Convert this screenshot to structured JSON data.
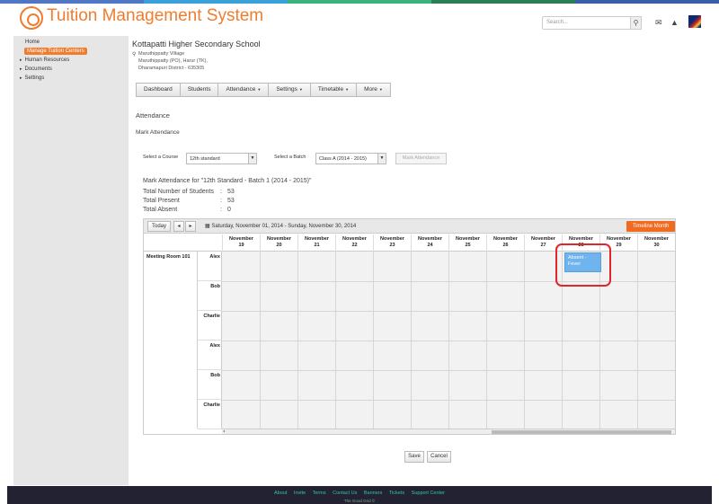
{
  "colors": {
    "brand": "#f07c2e",
    "accent": "#f06a20",
    "event": "#6fb3ef",
    "highlight": "#e0262b",
    "footer_link": "#34c7a0"
  },
  "header": {
    "title": "Tuition Management System",
    "search_placeholder": "Search...",
    "icons": [
      "search-icon",
      "mail-icon",
      "bell-icon"
    ]
  },
  "sidebar": {
    "items": [
      {
        "label": "Home"
      },
      {
        "label": "Manage Tuition Centers",
        "active": true
      },
      {
        "label": "Human Resources"
      },
      {
        "label": "Documents"
      },
      {
        "label": "Settings"
      }
    ]
  },
  "school": {
    "name": "Kottapatti Higher Secondary School",
    "address": [
      "Maruthippatty Village",
      "Maruthippatty (PO), Harur (TK),",
      "Dharamapuri District - 635305"
    ]
  },
  "nav": {
    "tabs": [
      {
        "label": "Dashboard"
      },
      {
        "label": "Students"
      },
      {
        "label": "Attendance"
      },
      {
        "label": "Settings"
      },
      {
        "label": "Timetable"
      },
      {
        "label": "More"
      }
    ]
  },
  "page": {
    "title": "Attendance",
    "subtitle": "Mark Attendance",
    "course_label": "Select a Course",
    "course_value": "12th standard",
    "batch_label": "Select a Batch",
    "batch_value": "Class A (2014 - 2015)",
    "mark_button": "Mark Attendance",
    "mark_heading": "Mark Attendance for \"12th Standard - Batch 1 (2014 - 2015)\"",
    "stats": [
      {
        "label": "Total Number of Students",
        "sep": ":",
        "value": "53"
      },
      {
        "label": "Total Present",
        "sep": ":",
        "value": "53"
      },
      {
        "label": "Total Absent",
        "sep": ":",
        "value": "0"
      }
    ]
  },
  "scheduler": {
    "today_label": "Today",
    "prev_label": "◂",
    "next_label": "▸",
    "date_range": "Saturday, November 01, 2014 - Sunday, November 30, 2014",
    "view_button": "Timeline Month",
    "days": [
      {
        "month": "November",
        "day": "19"
      },
      {
        "month": "November",
        "day": "20"
      },
      {
        "month": "November",
        "day": "21"
      },
      {
        "month": "November",
        "day": "22"
      },
      {
        "month": "November",
        "day": "23"
      },
      {
        "month": "November",
        "day": "24"
      },
      {
        "month": "November",
        "day": "25"
      },
      {
        "month": "November",
        "day": "26"
      },
      {
        "month": "November",
        "day": "27"
      },
      {
        "month": "November",
        "day": "28"
      },
      {
        "month": "November",
        "day": "29"
      },
      {
        "month": "November",
        "day": "30"
      }
    ],
    "room": "Meeting Room 101",
    "people": [
      "Alex",
      "Bob",
      "Charlie",
      "Alex",
      "Bob",
      "Charlie"
    ],
    "event": {
      "line1": "Absent -",
      "line2": "Fever",
      "person": "Alex",
      "day": "28"
    }
  },
  "actions": {
    "save": "Save",
    "cancel": "Cancel"
  },
  "footer": {
    "links": [
      "About",
      "Invite",
      "Terms",
      "Contact Us",
      "Banners",
      "Tickets",
      "Support Center"
    ],
    "copyright": "The Good Grid ©"
  }
}
